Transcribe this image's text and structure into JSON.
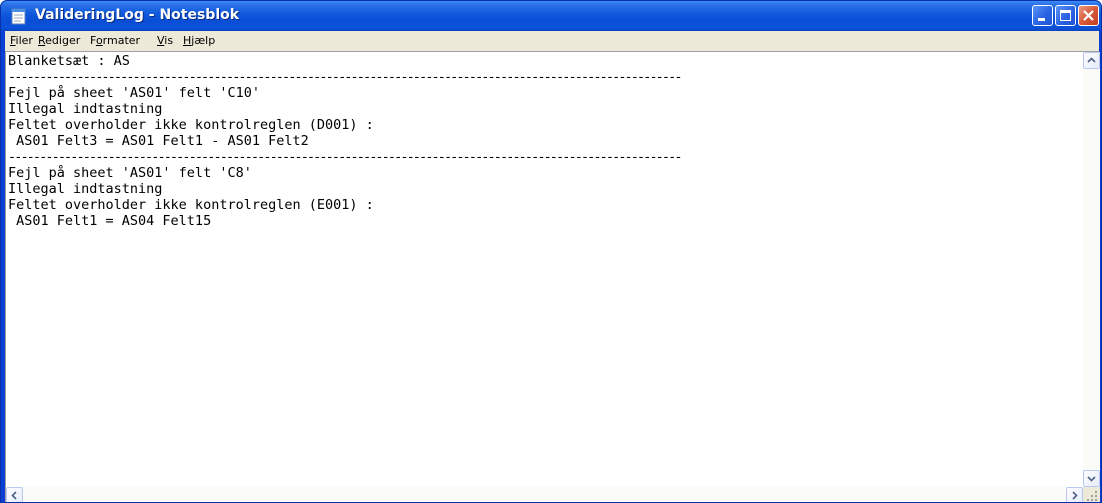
{
  "window": {
    "title": "ValideringLog - Notesblok",
    "icon": "notepad-icon"
  },
  "titlebar_buttons": {
    "minimize_icon": "minimize-icon",
    "maximize_icon": "maximize-icon",
    "close_icon": "close-icon"
  },
  "menu": {
    "items": [
      {
        "accel": "F",
        "rest": "iler"
      },
      {
        "accel": "R",
        "rest": "ediger"
      },
      {
        "pre": "F",
        "accel": "o",
        "rest": "rmater"
      },
      {
        "accel": "V",
        "rest": "is"
      },
      {
        "accel": "H",
        "rest": "jælp"
      }
    ]
  },
  "document": {
    "lines": [
      "Blanketsæt : AS",
      "------------------------------------------------------------------------------------------------------------",
      "Fejl på sheet 'AS01' felt 'C10'",
      "Illegal indtastning",
      "Feltet overholder ikke kontrolreglen (D001) :",
      " AS01 Felt3 = AS01 Felt1 - AS01 Felt2",
      "------------------------------------------------------------------------------------------------------------",
      "Fejl på sheet 'AS01' felt 'C8'",
      "Illegal indtastning",
      "Feltet overholder ikke kontrolreglen (E001) :",
      " AS01 Felt1 = AS04 Felt15"
    ]
  },
  "colors": {
    "titlebar": "#0a4ed6",
    "close_button": "#d85a3a",
    "face": "#ece9d8"
  }
}
